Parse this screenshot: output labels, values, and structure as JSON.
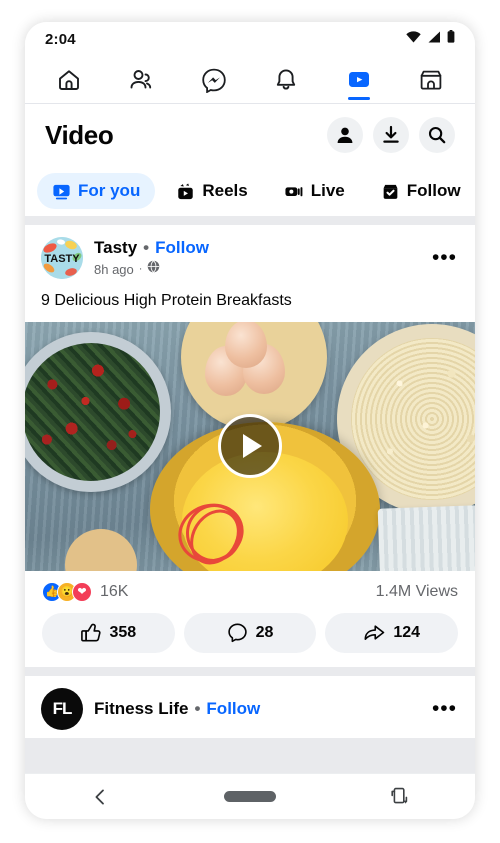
{
  "status_bar": {
    "time": "2:04",
    "icons": [
      "wifi-icon",
      "cellular-signal-icon",
      "battery-icon"
    ]
  },
  "top_nav": {
    "items": [
      {
        "name": "home",
        "icon": "home-icon",
        "active": false
      },
      {
        "name": "friends",
        "icon": "friends-icon",
        "active": false
      },
      {
        "name": "messenger",
        "icon": "messenger-icon",
        "active": false
      },
      {
        "name": "notifications",
        "icon": "bell-icon",
        "active": false
      },
      {
        "name": "video",
        "icon": "video-icon",
        "active": true
      },
      {
        "name": "marketplace",
        "icon": "marketplace-icon",
        "active": false
      }
    ],
    "active_color": "#0866ff"
  },
  "header": {
    "title": "Video",
    "actions": [
      {
        "name": "profile",
        "icon": "person-icon"
      },
      {
        "name": "downloads",
        "icon": "download-icon"
      },
      {
        "name": "search",
        "icon": "search-icon"
      }
    ]
  },
  "tabs": {
    "items": [
      {
        "label": "For you",
        "icon": "video-play-icon",
        "active": true
      },
      {
        "label": "Reels",
        "icon": "reels-icon",
        "active": false
      },
      {
        "label": "Live",
        "icon": "live-camera-icon",
        "active": false
      },
      {
        "label": "Follow",
        "icon": "following-check-icon",
        "active": false
      }
    ],
    "active_bg": "#e7f3ff",
    "active_fg": "#0866ff"
  },
  "posts": [
    {
      "page_name": "Tasty",
      "separator": "•",
      "follow_label": "Follow",
      "time_ago": "8h ago",
      "time_separator": "·",
      "privacy_icon": "globe-icon",
      "menu_icon": "more-options-icon",
      "caption": "9 Delicious High Protein Breakfasts",
      "avatar_text": "TASTY",
      "video": {
        "play_icon": "play-button-icon",
        "alt": "Overhead shot of breakfast ingredients: herb salsa, eggs in wooden bowl, couscous, and whisked eggs with red whisk on blue wood table"
      },
      "stats": {
        "reactions": [
          "like-reaction",
          "wow-reaction",
          "love-reaction"
        ],
        "reaction_count": "16K",
        "views": "1.4M Views"
      },
      "actions": [
        {
          "name": "like",
          "icon": "thumbs-up-icon",
          "count": "358"
        },
        {
          "name": "comment",
          "icon": "comment-bubble-icon",
          "count": "28"
        },
        {
          "name": "share",
          "icon": "share-arrow-icon",
          "count": "124"
        }
      ]
    },
    {
      "page_name": "Fitness Life",
      "separator": "•",
      "follow_label": "Follow",
      "menu_icon": "more-options-icon",
      "avatar_text": "FL"
    }
  ],
  "android_nav": {
    "back": "back-chevron-icon",
    "home": "home-pill-icon",
    "rotate": "rotate-screen-icon"
  }
}
